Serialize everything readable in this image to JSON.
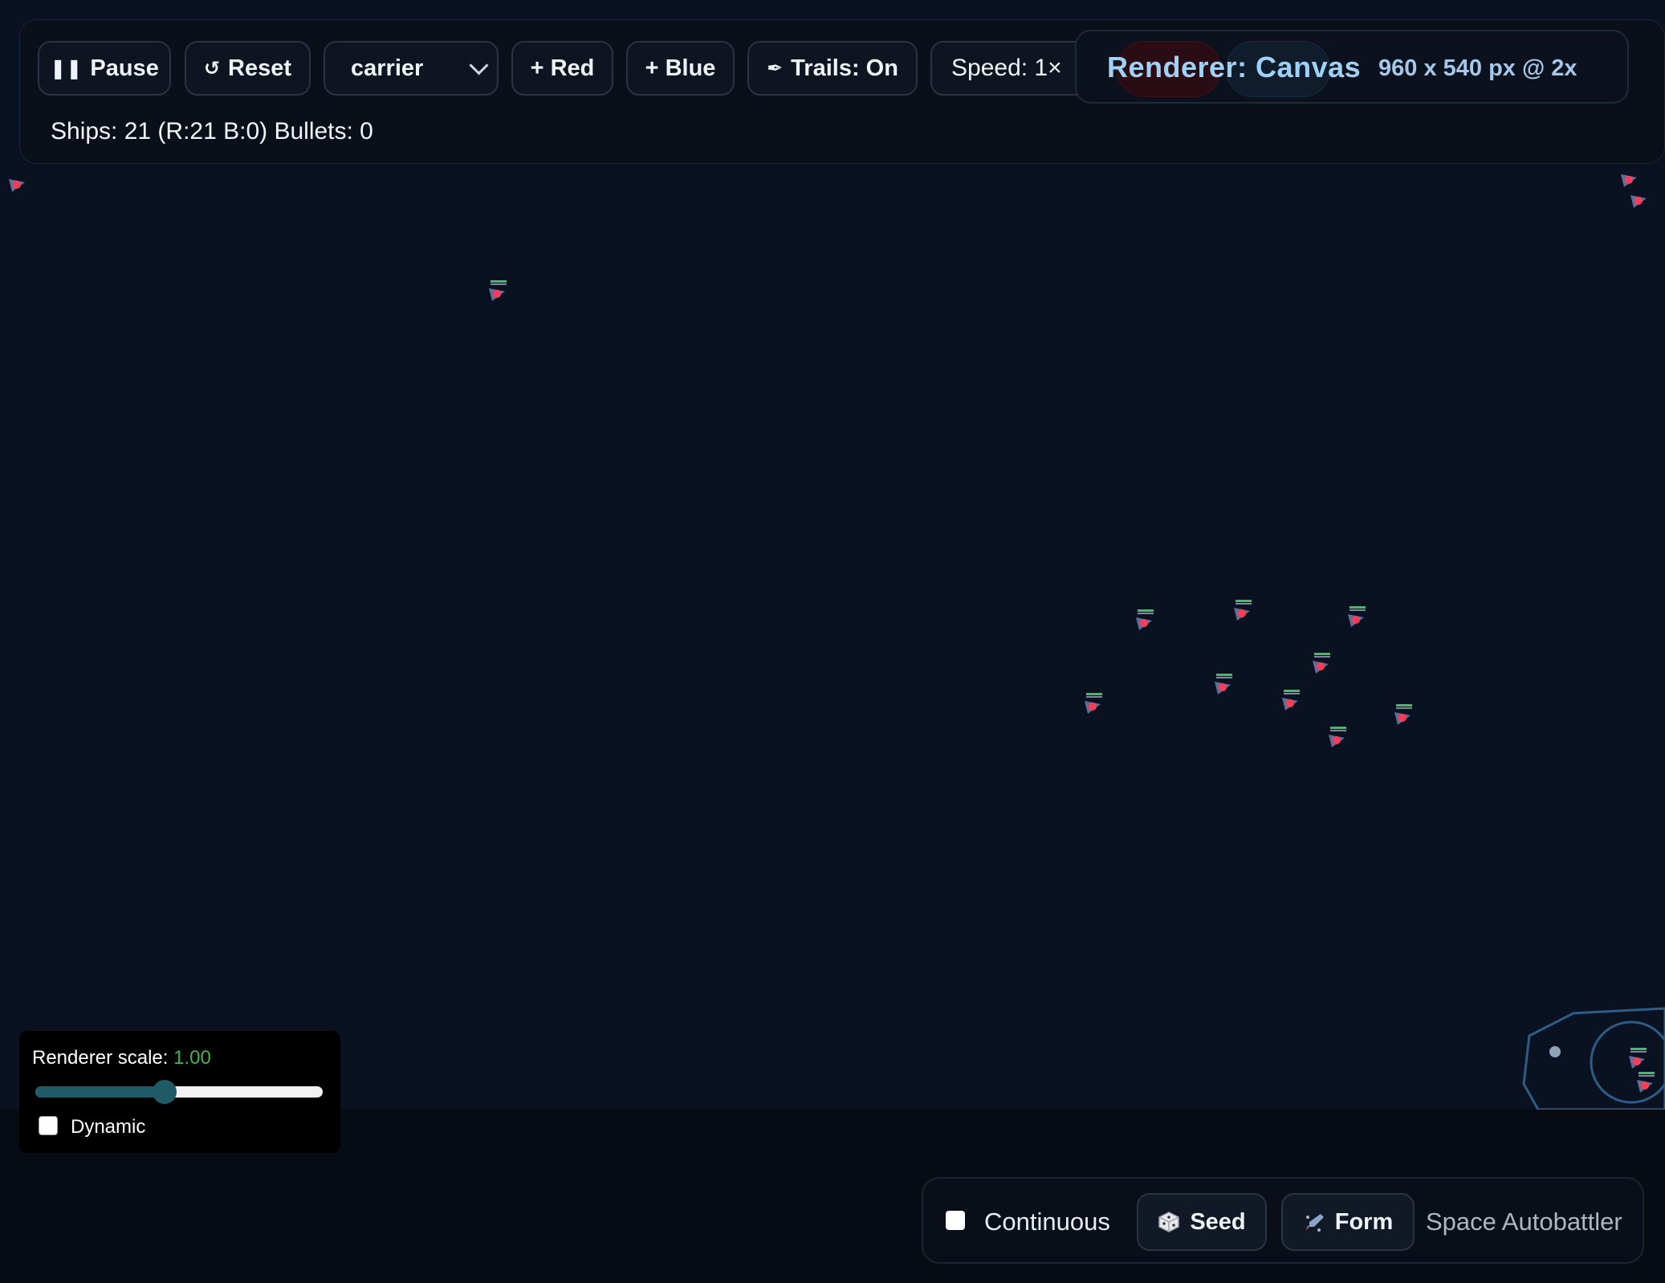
{
  "toolbar": {
    "pause_label": "Pause",
    "reset_label": "Reset",
    "ship_type_selected": "carrier",
    "add_red_label": "+ Red",
    "add_blue_label": "+ Blue",
    "trails_label": "Trails: On",
    "speed_label": "Speed: 1×",
    "renderer_label": "Renderer: Canvas",
    "renderer_dims": "960 x 540 px @ 2x",
    "stats": "Ships: 21 (R:21 B:0) Bullets: 0",
    "icons": {
      "pause": "pause-icon",
      "reset": "reset-icon",
      "trails": "brush-icon",
      "chevron": "chevron-down-icon"
    }
  },
  "scale_panel": {
    "label": "Renderer scale:",
    "value": "1.00",
    "slider_fraction": 0.45,
    "dynamic_label": "Dynamic",
    "dynamic_checked": false
  },
  "bottom_bar": {
    "continuous_label": "Continuous",
    "continuous_checked": false,
    "seed_label": "Seed",
    "form_label": "Form",
    "app_title": "Space Autobattler",
    "icons": {
      "seed": "dice-icon",
      "form": "formation-icon"
    }
  },
  "colors": {
    "canvas_bg": "#0a1222",
    "page_bg": "#060a13",
    "accent_value": "#4caf50",
    "renderer_text": "#9fd0f5",
    "red_team": "#ff3b5c",
    "health_bar": "#3fbf5f"
  },
  "ships": {
    "count": 21,
    "red": 21,
    "blue": 0
  }
}
